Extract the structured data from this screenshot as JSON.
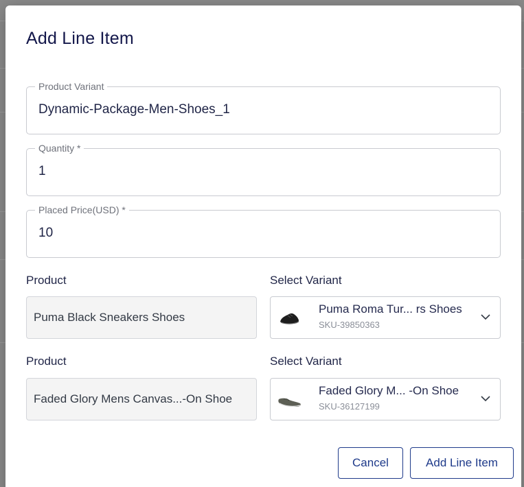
{
  "modal": {
    "title": "Add Line Item"
  },
  "fields": {
    "product_variant": {
      "label": "Product Variant",
      "value": "Dynamic-Package-Men-Shoes_1"
    },
    "quantity": {
      "label": "Quantity *",
      "value": "1"
    },
    "placed_price": {
      "label": "Placed Price(USD) *",
      "value": "10"
    }
  },
  "rows": [
    {
      "product_label": "Product",
      "product_value": "Puma Black Sneakers Shoes",
      "variant_label": "Select Variant",
      "variant_name": "Puma Roma Tur... rs Shoes",
      "variant_sku": "SKU-39850363",
      "thumb_icon": "black-sneaker-icon"
    },
    {
      "product_label": "Product",
      "product_value": "Faded Glory Mens Canvas...-On Shoe",
      "variant_label": "Select Variant",
      "variant_name": "Faded Glory M... -On Shoe",
      "variant_sku": "SKU-36127199",
      "thumb_icon": "canvas-slip-on-icon"
    }
  ],
  "buttons": {
    "cancel": "Cancel",
    "submit": "Add Line Item"
  },
  "colors": {
    "accent": "#1e3a8a",
    "title": "#13174a"
  }
}
